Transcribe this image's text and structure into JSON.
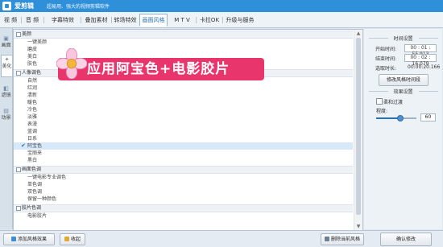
{
  "window": {
    "app_name": "爱剪辑",
    "slogan": "超易用、强大的视频剪辑软件"
  },
  "menu": {
    "tabs": [
      {
        "label": "视 频"
      },
      {
        "label": "音 频"
      },
      {
        "label": "字幕特效"
      },
      {
        "label": "叠加素材"
      },
      {
        "label": "转场特效"
      },
      {
        "label": "画面风格",
        "active": true
      },
      {
        "label": "M T V"
      },
      {
        "label": "卡拉OK"
      },
      {
        "label": "升级与服务"
      }
    ]
  },
  "sidebar": {
    "tabs": [
      {
        "label": "画面",
        "icon": "picture-icon"
      },
      {
        "label": "美化",
        "icon": "magic-wand-icon",
        "active": true
      },
      {
        "label": "滤镜",
        "icon": "filter-icon"
      },
      {
        "label": "动景",
        "icon": "motion-icon"
      }
    ]
  },
  "style_list": {
    "groups": [
      {
        "header": "美颜",
        "items": [
          "一键美颜",
          "磨皮",
          "美白",
          "肤色"
        ]
      },
      {
        "header": "人像调色",
        "items": [
          "自然",
          "红润",
          "清新",
          "暖色",
          "冷色",
          "淡雅",
          "表漫",
          "蓝调",
          "日系",
          "阿宝色",
          "宝丽来",
          "黑白"
        ]
      },
      {
        "header": "画面色调",
        "items": [
          "一键电影专业调色",
          "单色调",
          "双色调",
          "保留一种颜色"
        ]
      },
      {
        "header": "胶片色调",
        "items": [
          "电影胶片"
        ]
      }
    ],
    "selected_item": "阿宝色"
  },
  "banner": {
    "text": "应用阿宝色+电影胶片"
  },
  "bottom_buttons": {
    "add_style": "添加风格效果",
    "favorite": "收起",
    "delete_style": "删除当前风格"
  },
  "time_settings": {
    "title": "时间设置",
    "start_label": "开始时间:",
    "start_value": "00 : 01 : 55.913",
    "end_label": "结束时间:",
    "end_value": "00 : 02 : 16.079",
    "duration_label": "选取时长:",
    "duration_value": "00:00:20.166",
    "modify_time_button": "修改风格时间段"
  },
  "effect_settings": {
    "title": "效果设置",
    "soft_transition_label": "柔和过渡",
    "soft_transition_checked": false,
    "degree_label": "程度:",
    "degree_value": 60,
    "degree_max": 100
  },
  "confirm_button": "确认修改",
  "colors": {
    "titlebar": "#2f8fd8",
    "banner": "#e8366d",
    "selection": "#d6e8fa",
    "accent": "#2a6fb0"
  }
}
